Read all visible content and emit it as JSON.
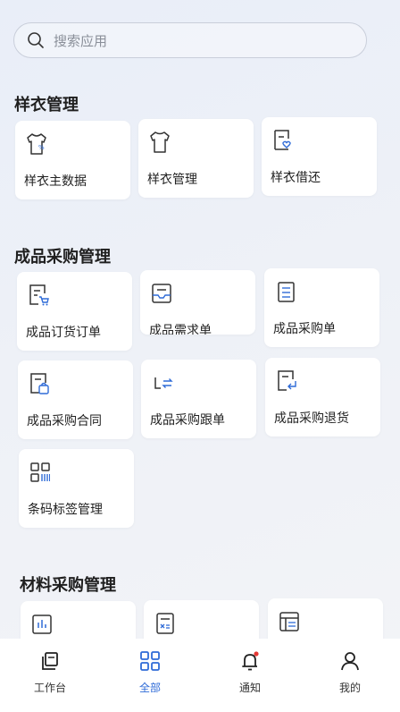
{
  "search": {
    "placeholder": "搜索应用"
  },
  "sections": [
    {
      "title": "样衣管理",
      "items": [
        "样衣主数据",
        "样衣管理",
        "样衣借还"
      ]
    },
    {
      "title": "成品采购管理",
      "items": [
        "成品订货订单",
        "成品需求单",
        "成品采购单",
        "成品采购合同",
        "成品采购跟单",
        "成品采购退货",
        "条码标签管理"
      ]
    },
    {
      "title": "材料采购管理"
    }
  ],
  "tabs": [
    {
      "label": "工作台",
      "icon": "workbench-icon"
    },
    {
      "label": "全部",
      "icon": "grid-icon",
      "active": true
    },
    {
      "label": "通知",
      "icon": "bell-icon",
      "badge": true
    },
    {
      "label": "我的",
      "icon": "user-icon"
    }
  ],
  "colors": {
    "accent": "#2f6bd7",
    "badge": "#e53935"
  }
}
